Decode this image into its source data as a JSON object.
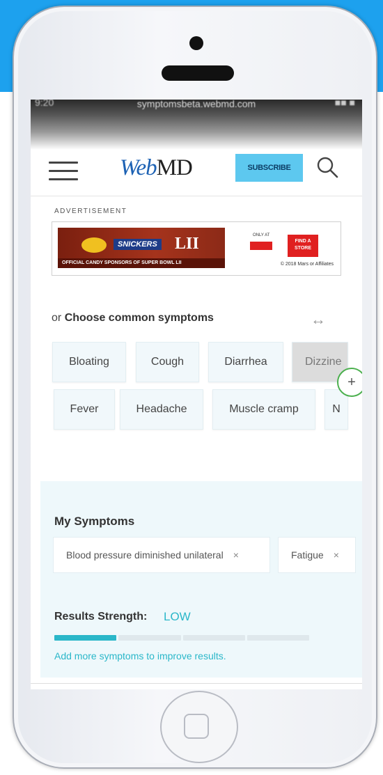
{
  "status_bar": {
    "url": "symptomsbeta.webmd.com",
    "left": "9:20",
    "right": "■■ ■"
  },
  "header": {
    "logo_web": "Web",
    "logo_md": "MD",
    "subscribe_label": "SUBSCRIBE"
  },
  "ad": {
    "label": "ADVERTISEMENT",
    "brand": "SNICKERS",
    "event": "LII",
    "tagline": "OFFICIAL CANDY SPONSORS OF SUPER BOWL LII",
    "only_at": "ONLY AT",
    "cta": "FIND A STORE",
    "copyright": "© 2018 Mars or Affiliates"
  },
  "common": {
    "prefix": "or",
    "title": "Choose common symptoms",
    "scroll_hint": "↔",
    "row1": [
      "Bloating",
      "Cough",
      "Diarrhea",
      "Dizzine"
    ],
    "row2": [
      "Fever",
      "Headache",
      "Muscle cramp",
      "N"
    ]
  },
  "my_symptoms": {
    "title": "My Symptoms",
    "items": [
      "Blood pressure diminished unilateral",
      "Fatigue"
    ],
    "remove_glyph": "×"
  },
  "results": {
    "label": "Results Strength:",
    "value": "LOW",
    "level_segments_filled": 1,
    "level_segments_total": 4,
    "hint": "Add more symptoms to improve results."
  },
  "colors": {
    "brand_blue": "#1d62b4",
    "accent_teal": "#2ab7c9",
    "subscribe_bg": "#5dc8ef",
    "outer_bg": "#1da1ee"
  }
}
